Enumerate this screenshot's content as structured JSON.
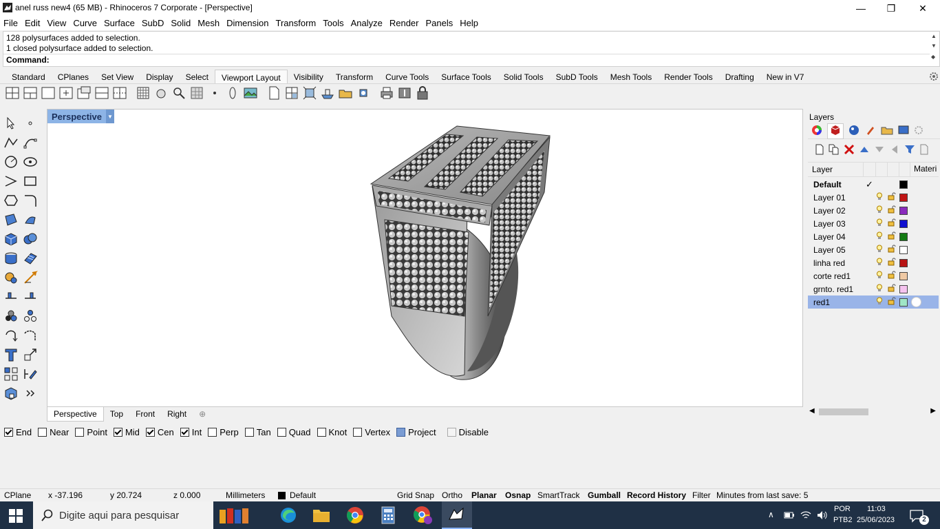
{
  "window": {
    "title": "anel russ new4 (65 MB) - Rhinoceros 7 Corporate - [Perspective]",
    "minimize": "—",
    "maximize": "❐",
    "close": "✕"
  },
  "menu": [
    "File",
    "Edit",
    "View",
    "Curve",
    "Surface",
    "SubD",
    "Solid",
    "Mesh",
    "Dimension",
    "Transform",
    "Tools",
    "Analyze",
    "Render",
    "Panels",
    "Help"
  ],
  "command": {
    "history": [
      "128 polysurfaces added to selection.",
      "1 closed polysurface added to selection."
    ],
    "prompt": "Command:"
  },
  "toolbar_tabs": [
    "Standard",
    "CPlanes",
    "Set View",
    "Display",
    "Select",
    "Viewport Layout",
    "Visibility",
    "Transform",
    "Curve Tools",
    "Surface Tools",
    "Solid Tools",
    "SubD Tools",
    "Mesh Tools",
    "Render Tools",
    "Drafting",
    "New in V7"
  ],
  "active_toolbar_tab": "Viewport Layout",
  "viewport": {
    "title": "Perspective",
    "tabs": [
      "Perspective",
      "Top",
      "Front",
      "Right"
    ],
    "add_tab": "⊕"
  },
  "osnaps": [
    {
      "label": "End",
      "checked": true
    },
    {
      "label": "Near",
      "checked": false
    },
    {
      "label": "Point",
      "checked": false
    },
    {
      "label": "Mid",
      "checked": true
    },
    {
      "label": "Cen",
      "checked": true
    },
    {
      "label": "Int",
      "checked": true
    },
    {
      "label": "Perp",
      "checked": false
    },
    {
      "label": "Tan",
      "checked": false
    },
    {
      "label": "Quad",
      "checked": false
    },
    {
      "label": "Knot",
      "checked": false
    },
    {
      "label": "Vertex",
      "checked": false
    },
    {
      "label": "Project",
      "checked": "filled"
    },
    {
      "label": "Disable",
      "checked": "grey"
    }
  ],
  "layers_panel": {
    "title": "Layers",
    "col_layer": "Layer",
    "col_material": "Materi",
    "layers": [
      {
        "name": "Default",
        "color": "#000000",
        "current": true
      },
      {
        "name": "Layer 01",
        "color": "#c01515"
      },
      {
        "name": "Layer 02",
        "color": "#8a2bbd"
      },
      {
        "name": "Layer 03",
        "color": "#1111d0"
      },
      {
        "name": "Layer 04",
        "color": "#137a13"
      },
      {
        "name": "Layer 05",
        "color": "#ffffff"
      },
      {
        "name": "linha red",
        "color": "#b81414"
      },
      {
        "name": "corte red1",
        "color": "#efc9a4"
      },
      {
        "name": "grnto. red1",
        "color": "#f5c3ef"
      },
      {
        "name": "red1",
        "color": "#9fe6c6",
        "selected": true
      }
    ]
  },
  "status": {
    "cplane": "CPlane",
    "x": "x -37.196",
    "y": "y 20.724",
    "z": "z 0.000",
    "units": "Millimeters",
    "layer": "Default",
    "grid_snap": "Grid Snap",
    "ortho": "Ortho",
    "planar": "Planar",
    "osnap": "Osnap",
    "smarttrack": "SmartTrack",
    "gumball": "Gumball",
    "record_history": "Record History",
    "filter": "Filter",
    "save_info": "Minutes from last save: 5"
  },
  "taskbar": {
    "search_placeholder": "Digite aqui para pesquisar",
    "lang1": "POR",
    "lang2": "PTB2",
    "time": "11:03",
    "date": "25/06/2023",
    "notifications": "2"
  }
}
